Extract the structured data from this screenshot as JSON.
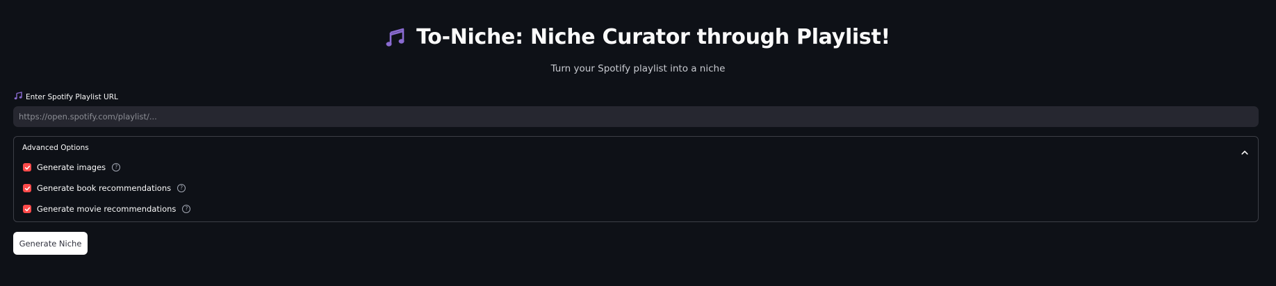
{
  "header": {
    "title": "To-Niche: Niche Curator through Playlist!",
    "title_icon": "music-notes-icon",
    "subtitle": "Turn your Spotify playlist into a niche"
  },
  "playlist_input": {
    "label": "Enter Spotify Playlist URL",
    "label_icon": "music-note-icon",
    "value": "",
    "placeholder": "https://open.spotify.com/playlist/..."
  },
  "advanced_options": {
    "title": "Advanced Options",
    "expanded": true,
    "options": [
      {
        "label": "Generate images",
        "checked": true
      },
      {
        "label": "Generate book recommendations",
        "checked": true
      },
      {
        "label": "Generate movie recommendations",
        "checked": true
      }
    ]
  },
  "actions": {
    "generate_label": "Generate Niche"
  },
  "colors": {
    "background": "#0e1117",
    "input_background": "#262730",
    "checkbox_accent": "#ff4b4b",
    "icon_purple": "#8a6bd1",
    "button_background": "#ffffff"
  }
}
